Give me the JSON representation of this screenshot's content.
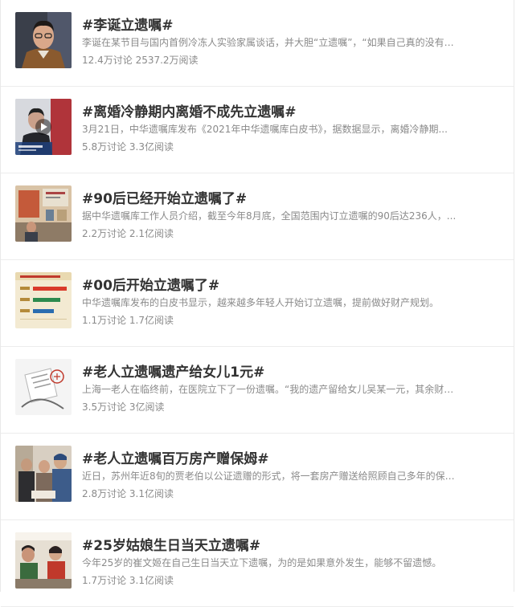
{
  "topics": [
    {
      "title": "#李诞立遗嘱#",
      "summary": "李诞在某节目与国内首例冷冻人实验家属谈话，并大胆“立遗嘱”，“如果自己真的没有意...",
      "discussions": "12.4万讨论",
      "reads": "2537.2万阅读",
      "thumb_icon": "man-with-glasses-photo"
    },
    {
      "title": "#离婚冷静期内离婚不成先立遗嘱#",
      "summary": "3月21日，中华遗嘱库发布《2021年中华遗嘱库白皮书》，据数据显示，离婚冷静期...",
      "discussions": "5.8万讨论",
      "reads": "3.3亿阅读",
      "thumb_icon": "video-play-icon"
    },
    {
      "title": "#90后已经开始立遗嘱了#",
      "summary": "据中华遗嘱库工作人员介绍，截至今年8月底，全国范围内订立遗嘱的90后达236人，...",
      "discussions": "2.2万讨论",
      "reads": "2.1亿阅读",
      "thumb_icon": "office-photo"
    },
    {
      "title": "#00后开始立遗嘱了#",
      "summary": "中华遗嘱库发布的白皮书显示，越来越多年轻人开始订立遗嘱，提前做好财产规划。",
      "discussions": "1.1万讨论",
      "reads": "1.7亿阅读",
      "thumb_icon": "bar-chart-document"
    },
    {
      "title": "#老人立遗嘱遗产给女儿1元#",
      "summary": "上海一老人在临终前，在医院立下了一份遗嘱。“我的遗产留给女儿吴某一元，其余财产包...",
      "discussions": "3.5万讨论",
      "reads": "3亿阅读",
      "thumb_icon": "will-stamp-illustration"
    },
    {
      "title": "#老人立遗嘱百万房产赠保姆#",
      "summary": "近日，苏州年近8旬的贾老伯以公证遗赠的形式，将一套房产赠送给照顾自己多年的保姆。...",
      "discussions": "2.8万讨论",
      "reads": "3.1亿阅读",
      "thumb_icon": "elderly-group-photo"
    },
    {
      "title": "#25岁姑娘生日当天立遗嘱#",
      "summary": "今年25岁的崔文姬在自己生日当天立下遗嘱，为的是如果意外发生，能够不留遗憾。",
      "discussions": "1.7万讨论",
      "reads": "3.1亿阅读",
      "thumb_icon": "women-at-counter-photo"
    }
  ],
  "colors": {
    "title": "#333333",
    "meta": "#8a8a8a",
    "divider": "#ececec"
  }
}
